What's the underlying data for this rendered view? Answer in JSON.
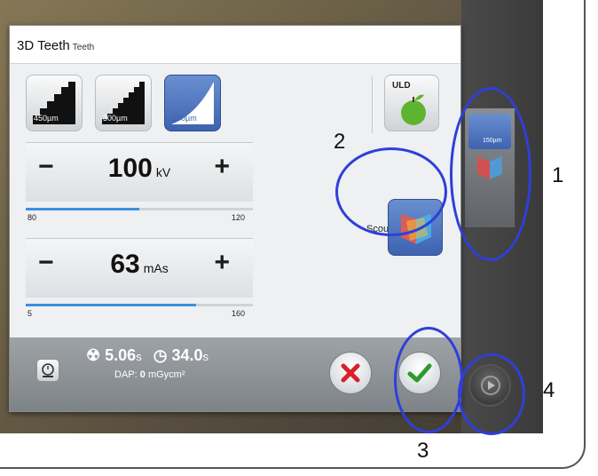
{
  "dialog": {
    "title": "3D Teeth",
    "subtitle": "Teeth"
  },
  "resolution": {
    "buttons": [
      {
        "label": "450µm",
        "selected": false
      },
      {
        "label": "300µm",
        "selected": false
      },
      {
        "label": "150µm",
        "selected": true
      }
    ],
    "uld_label": "ULD"
  },
  "scout": {
    "label": "Scout"
  },
  "kv": {
    "minus": "−",
    "plus": "+",
    "value": "100",
    "unit": "kV",
    "min": "80",
    "max": "120",
    "level_fraction": 0.5
  },
  "mas": {
    "minus": "−",
    "plus": "+",
    "value": "63",
    "unit": "mAs",
    "min": "5",
    "max": "160",
    "level_fraction": 0.75
  },
  "footer": {
    "dose_time": "5.06",
    "dose_time_unit": "s",
    "scan_time": "34.0",
    "scan_time_unit": "s",
    "dap_label": "DAP:",
    "dap_value": "0",
    "dap_unit": "mGycm²"
  },
  "side_panel": {
    "label": "150µm"
  },
  "annotations": [
    "1",
    "2",
    "3",
    "4"
  ],
  "colors": {
    "accent_blue": "#3d63b0",
    "slider_blue": "#3b8fe0",
    "annotation_circle": "#2f3fd8",
    "cancel_red": "#d8202a",
    "confirm_green": "#2e9a2e"
  },
  "icons": {
    "radiation": "radiation-icon",
    "timer": "timer-icon",
    "apple": "apple-icon",
    "scout": "scout-icon",
    "cancel": "cancel-icon",
    "confirm": "checkmark-icon",
    "play": "play-icon"
  }
}
